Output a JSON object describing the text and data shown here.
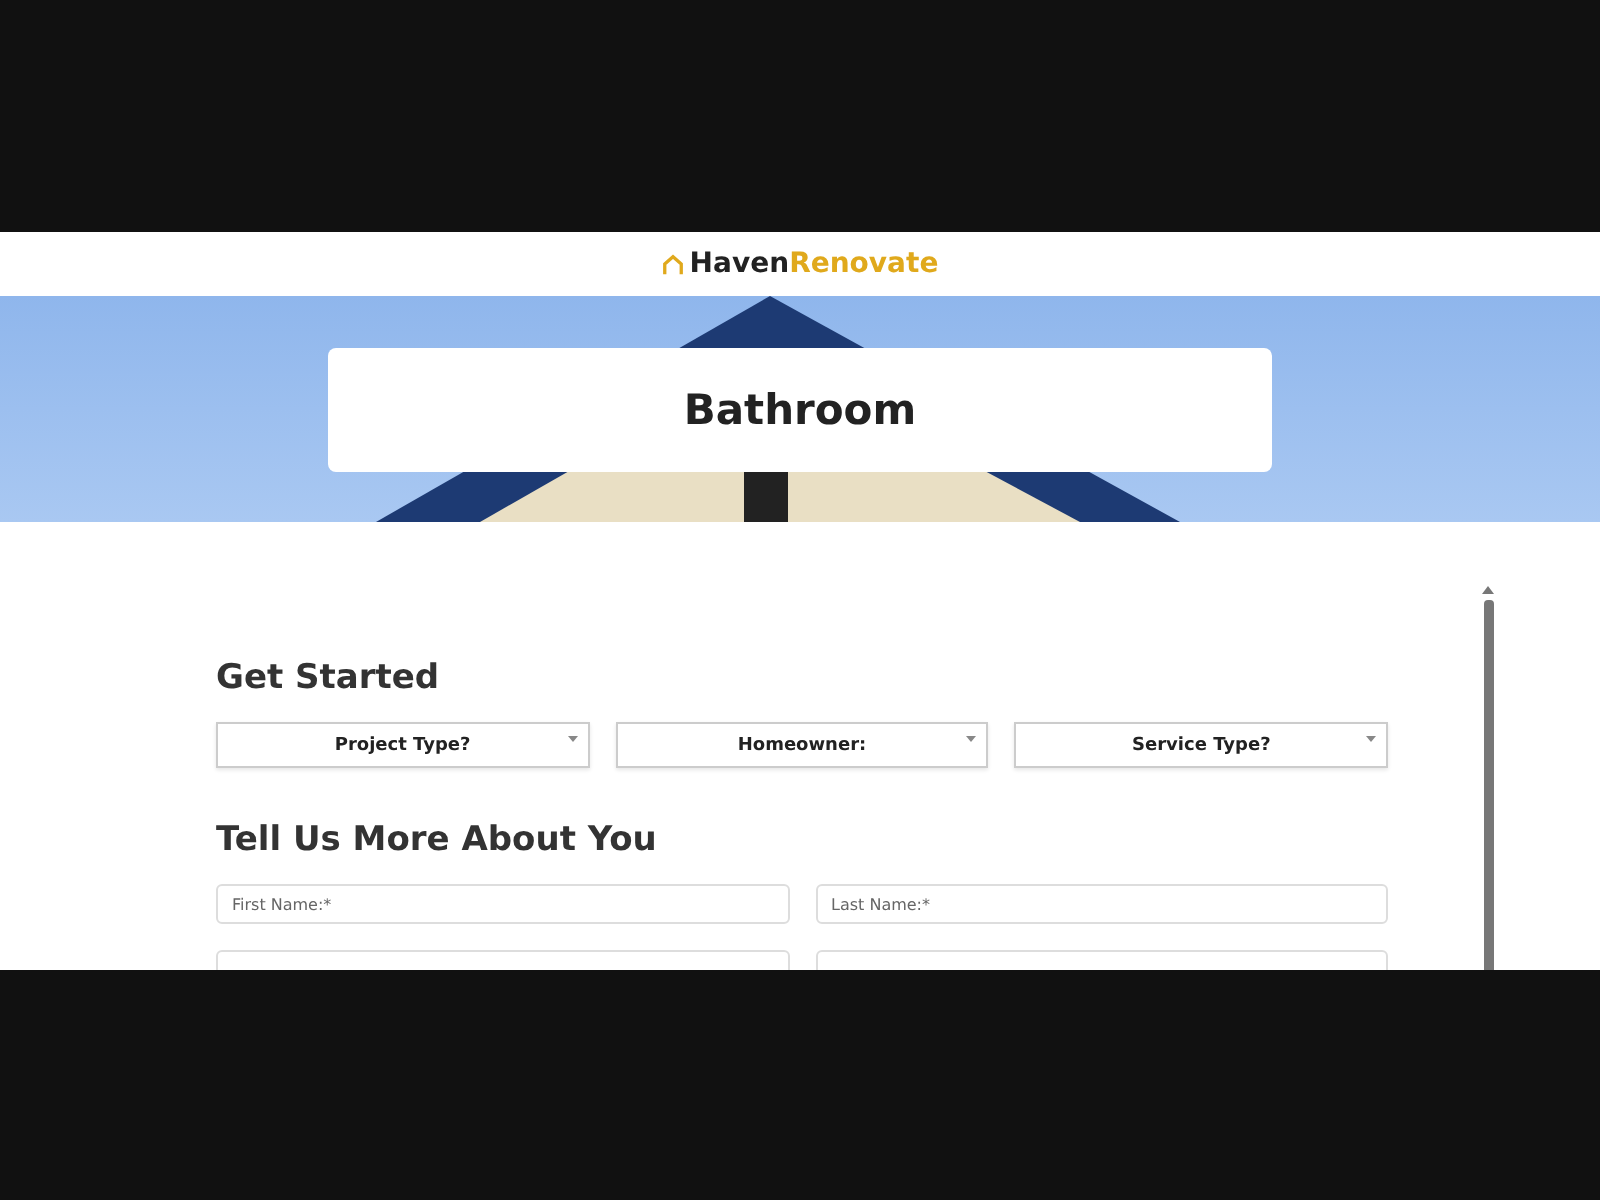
{
  "brand": {
    "name_part_1": "Haven",
    "name_part_2": "Renovate"
  },
  "hero": {
    "title": "Bathroom"
  },
  "get_started": {
    "heading": "Get Started",
    "selects": [
      {
        "label": "Project Type?"
      },
      {
        "label": "Homeowner:"
      },
      {
        "label": "Service Type?"
      }
    ]
  },
  "about_you": {
    "heading": "Tell Us More About You",
    "fields": [
      {
        "kind": "text",
        "placeholder": "First Name:*"
      },
      {
        "kind": "text",
        "placeholder": "Last Name:*"
      },
      {
        "kind": "blank"
      },
      {
        "kind": "blank"
      }
    ]
  }
}
